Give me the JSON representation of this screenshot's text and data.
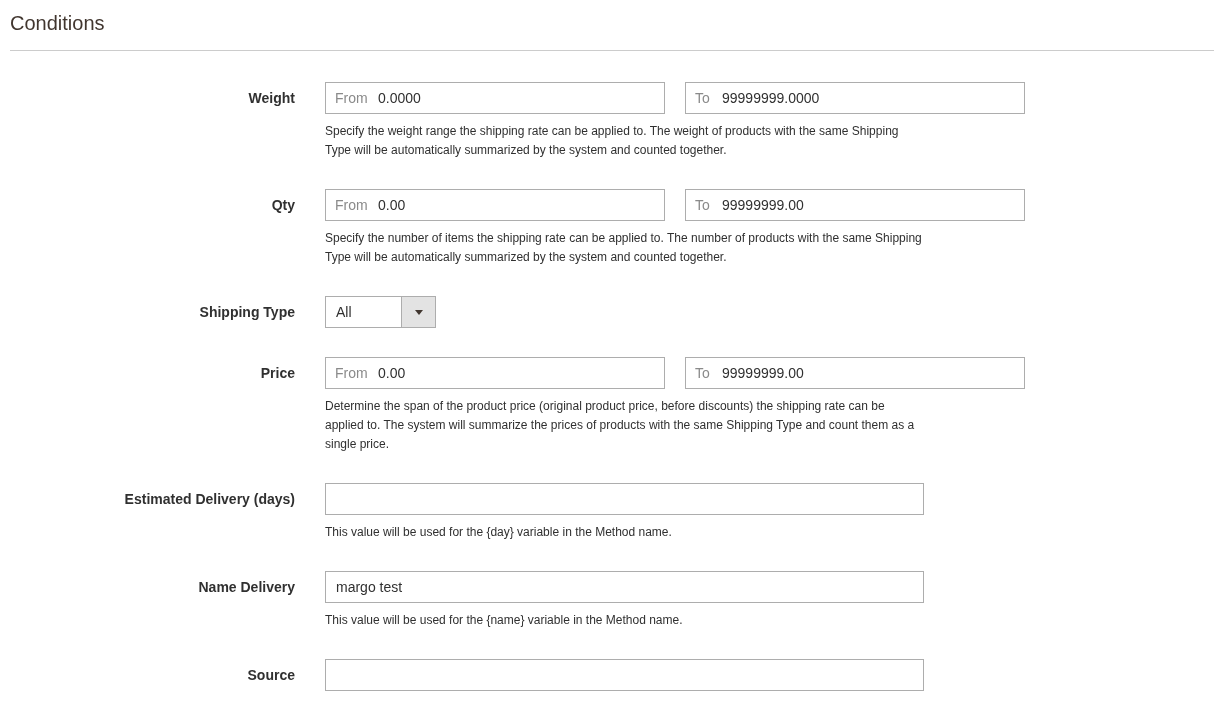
{
  "section": {
    "title": "Conditions"
  },
  "rows": [
    {
      "kind": "range",
      "label": "Weight",
      "from": {
        "prefix": "From",
        "value": "0.0000"
      },
      "to": {
        "prefix": "To",
        "value": "99999999.0000"
      },
      "note": "Specify the weight range the shipping rate can be applied to. The weight of products with the same Shipping Type will be automatically summarized by the system and counted together."
    },
    {
      "kind": "range",
      "label": "Qty",
      "from": {
        "prefix": "From",
        "value": "0.00"
      },
      "to": {
        "prefix": "To",
        "value": "99999999.00"
      },
      "note": "Specify the number of items the shipping rate can be applied to. The number of products with the same Shipping Type will be automatically summarized by the system and counted together."
    },
    {
      "kind": "select",
      "label": "Shipping Type",
      "value": "All"
    },
    {
      "kind": "range",
      "label": "Price",
      "from": {
        "prefix": "From",
        "value": "0.00"
      },
      "to": {
        "prefix": "To",
        "value": "99999999.00"
      },
      "note": "Determine the span of the product price (original product price, before discounts) the shipping rate can be applied to. The system will summarize the prices of products with the same Shipping Type and count them as a single price."
    },
    {
      "kind": "text",
      "label": "Estimated Delivery (days)",
      "value": "",
      "note": "This value will be used for the {day} variable in the Method name."
    },
    {
      "kind": "text",
      "label": "Name Delivery",
      "value": "margo test",
      "note": "This value will be used for the {name} variable in the Method name."
    },
    {
      "kind": "text",
      "label": "Source",
      "value": ""
    }
  ]
}
